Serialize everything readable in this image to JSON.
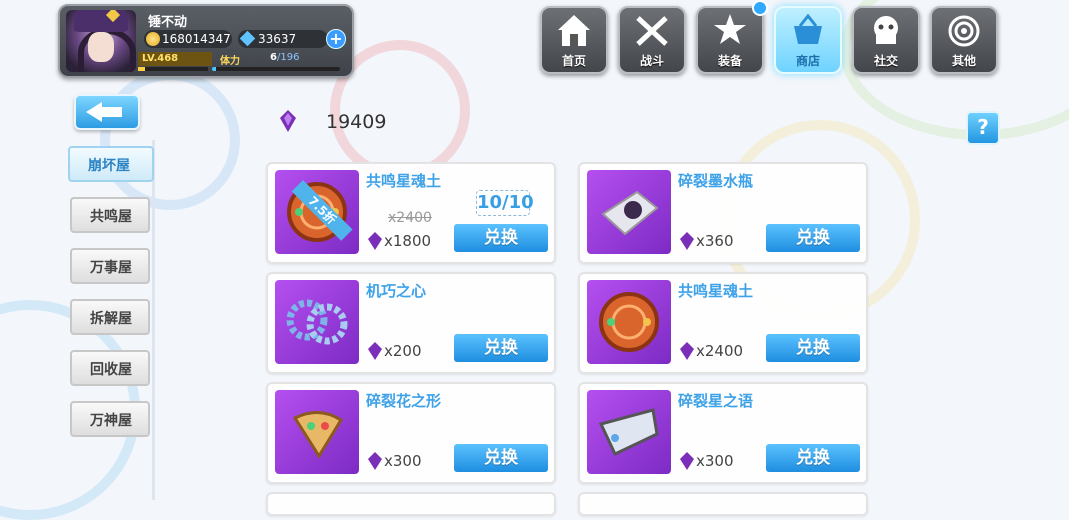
{
  "player": {
    "name": "锤不动",
    "gold": "168014347",
    "diamond": "33637",
    "level": "LV.468",
    "stamina_label": "体力",
    "stamina": "6",
    "stamina_max": "/196",
    "stamina_fraction": 0.03,
    "xp_fraction": 0.1
  },
  "nav": [
    {
      "label": "首页",
      "icon": "house-icon"
    },
    {
      "label": "战斗",
      "icon": "crossed-swords-icon"
    },
    {
      "label": "装备",
      "icon": "star-gun-icon"
    },
    {
      "label": "商店",
      "icon": "basket-icon",
      "active": true
    },
    {
      "label": "社交",
      "icon": "ghost-icon"
    },
    {
      "label": "其他",
      "icon": "target-icon"
    }
  ],
  "currency": {
    "value": "19409",
    "icon": "purple-gem-icon"
  },
  "help_label": "?",
  "tabs": [
    "崩坏屋",
    "共鸣屋",
    "万事屋",
    "拆解屋",
    "回收屋",
    "万神屋"
  ],
  "active_tab": 0,
  "items": [
    {
      "name": "共鸣星魂土",
      "price": "x1800",
      "old_price": "x2400",
      "discount": "7.5折",
      "limit": "10/10",
      "button": "兑换",
      "icon": "disc-icon"
    },
    {
      "name": "碎裂墨水瓶",
      "price": "x360",
      "button": "兑换",
      "icon": "ink-bottle-icon"
    },
    {
      "name": "机巧之心",
      "price": "x200",
      "button": "兑换",
      "icon": "gear-icon"
    },
    {
      "name": "共鸣星魂土",
      "price": "x2400",
      "button": "兑换",
      "icon": "disc-icon"
    },
    {
      "name": "碎裂花之形",
      "price": "x300",
      "button": "兑换",
      "icon": "fan-shard-icon"
    },
    {
      "name": "碎裂星之语",
      "price": "x300",
      "button": "兑换",
      "icon": "shard-icon"
    }
  ],
  "colors": {
    "accent": "#2c9ce3",
    "item_bg": "#9b3be0",
    "name": "#3ea2e8"
  }
}
